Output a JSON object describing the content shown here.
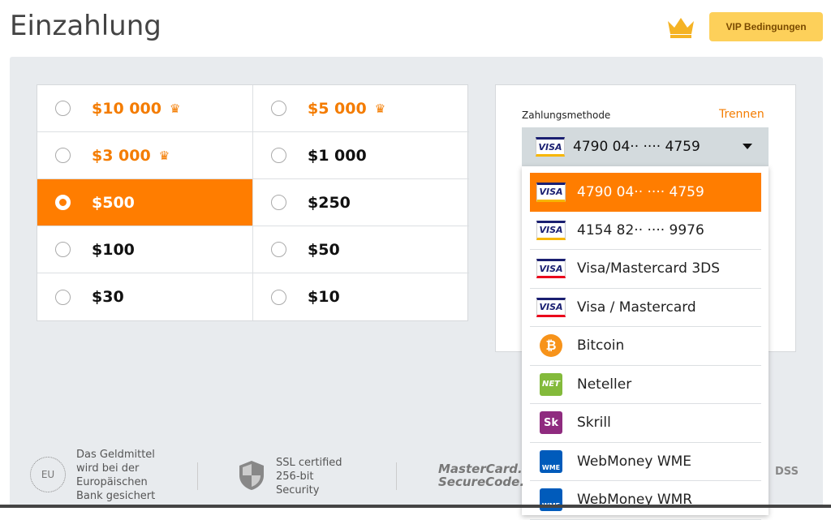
{
  "header": {
    "title": "Einzahlung",
    "vip_button": "VIP Bedingungen",
    "accent": "#ff7d00"
  },
  "amounts": [
    {
      "label": "$10 000",
      "vip": true,
      "selected": false
    },
    {
      "label": "$5 000",
      "vip": true,
      "selected": false
    },
    {
      "label": "$3 000",
      "vip": true,
      "selected": false
    },
    {
      "label": "$1 000",
      "vip": false,
      "selected": false
    },
    {
      "label": "$500",
      "vip": false,
      "selected": true
    },
    {
      "label": "$250",
      "vip": false,
      "selected": false
    },
    {
      "label": "$100",
      "vip": false,
      "selected": false
    },
    {
      "label": "$50",
      "vip": false,
      "selected": false
    },
    {
      "label": "$30",
      "vip": false,
      "selected": false
    },
    {
      "label": "$10",
      "vip": false,
      "selected": false
    }
  ],
  "payment": {
    "label": "Zahlungsmethode",
    "unlink": "Trennen",
    "selected": "4790 04·· ···· 4759",
    "options": [
      {
        "label": "4790 04·· ···· 4759",
        "icon": "visa",
        "selected": true
      },
      {
        "label": "4154 82·· ···· 9976",
        "icon": "visa"
      },
      {
        "label": "Visa/Mastercard 3DS",
        "icon": "visa-mastercard"
      },
      {
        "label": "Visa / Mastercard",
        "icon": "visa-mastercard"
      },
      {
        "label": "Bitcoin",
        "icon": "bitcoin"
      },
      {
        "label": "Neteller",
        "icon": "neteller"
      },
      {
        "label": "Skrill",
        "icon": "skrill"
      },
      {
        "label": "WebMoney WME",
        "icon": "webmoney"
      },
      {
        "label": "WebMoney WMR",
        "icon": "webmoney"
      }
    ]
  },
  "footer": {
    "eu_text": "Das Geldmittel wird bei der Europäischen Bank gesichert",
    "eu_logo": "EU",
    "ssl_text": "SSL certified 256-bit Security",
    "mastercard": "MasterCard. SecureCode.",
    "pci": "DSS"
  }
}
